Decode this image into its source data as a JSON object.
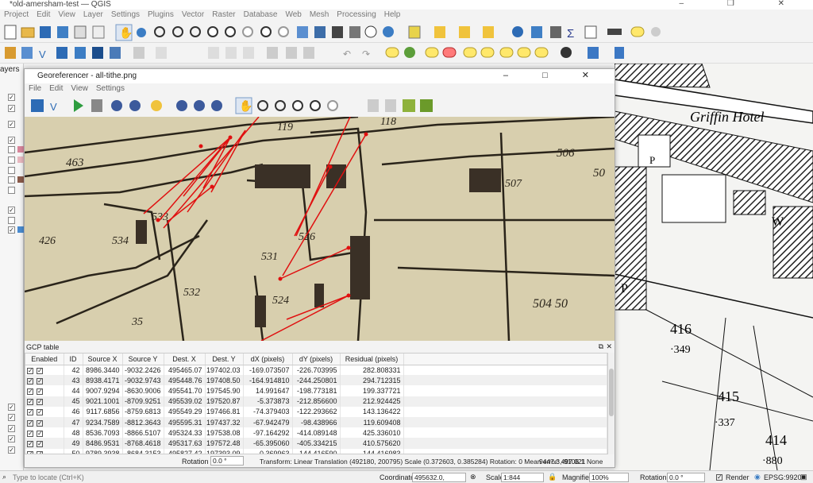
{
  "app": {
    "title": "*old-amersham-test — QGIS"
  },
  "menu": [
    "Project",
    "Edit",
    "View",
    "Layer",
    "Settings",
    "Plugins",
    "Vector",
    "Raster",
    "Database",
    "Web",
    "Mesh",
    "Processing",
    "Help"
  ],
  "layers_panel": {
    "label": "ayers"
  },
  "georef": {
    "title": "Georeferencer - all-tithe.png",
    "menu": [
      "File",
      "Edit",
      "View",
      "Settings"
    ],
    "gcp_table_label": "GCP table",
    "columns": [
      "Enabled",
      "ID",
      "Source X",
      "Source Y",
      "Dest. X",
      "Dest. Y",
      "dX (pixels)",
      "dY (pixels)",
      "Residual (pixels)"
    ],
    "rows": [
      [
        "42",
        "8986.3440",
        "-9032.2426",
        "495465.07",
        "197402.03",
        "-169.073507",
        "-226.703995",
        "282.808331"
      ],
      [
        "43",
        "8938.4171",
        "-9032.9743",
        "495448.76",
        "197408.50",
        "-164.914810",
        "-244.250801",
        "294.712315"
      ],
      [
        "44",
        "9007.9294",
        "-8630.9006",
        "495541.70",
        "197545.90",
        "14.991647",
        "-198.773181",
        "199.337721"
      ],
      [
        "45",
        "9021.1001",
        "-8709.9251",
        "495539.02",
        "197520.87",
        "-5.373873",
        "-212.856600",
        "212.924425"
      ],
      [
        "46",
        "9117.6856",
        "-8759.6813",
        "495549.29",
        "197466.81",
        "-74.379403",
        "-122.293662",
        "143.136422"
      ],
      [
        "47",
        "9234.7589",
        "-8812.3643",
        "495595.31",
        "197437.32",
        "-67.942479",
        "-98.438966",
        "119.609408"
      ],
      [
        "48",
        "8536.7093",
        "-8866.5107",
        "495324.33",
        "197538.08",
        "-97.164292",
        "-414.089148",
        "425.336010"
      ],
      [
        "49",
        "8486.9531",
        "-8768.4618",
        "495317.63",
        "197572.48",
        "-65.395060",
        "-405.334215",
        "410.575620"
      ],
      [
        "50",
        "9789.3938",
        "-8684.3153",
        "495827.42",
        "197393.09",
        "0.369963",
        "144.416590",
        "144.416983"
      ]
    ],
    "status": {
      "rotation_label": "Rotation",
      "rotation_value": "0.0 °",
      "transform": "Transform: Linear Translation (492180, 200795) Scale (0.372603, 0.385284) Rotation: 0 Mean error: 497.021",
      "coords": "9447.3,-9106.1",
      "none": "None"
    },
    "map_labels": [
      "463",
      "119",
      "118",
      "506",
      "50",
      "507",
      "534",
      "533",
      "526",
      "531",
      "532",
      "524",
      "35",
      "504 50",
      "426"
    ]
  },
  "basemap_labels": {
    "hotel": "Griffin Hotel",
    "p": "P",
    "w": "W",
    "p2": "P",
    "n416": "416",
    "n349": "·349",
    "n415": "415",
    "n337": "·337",
    "n414": "414",
    "n880": "·880"
  },
  "statusbar": {
    "locate_placeholder": "Type to locate (Ctrl+K)",
    "coordinate_label": "Coordinate",
    "coordinate_value": "495632.0, 197154.1",
    "scale_label": "Scale",
    "scale_value": "1:844",
    "magnifier_label": "Magnifier",
    "magnifier_value": "100%",
    "rotation_label": "Rotation",
    "rotation_value": "0.0 °",
    "render_label": "Render",
    "crs": "EPSG:9920"
  }
}
